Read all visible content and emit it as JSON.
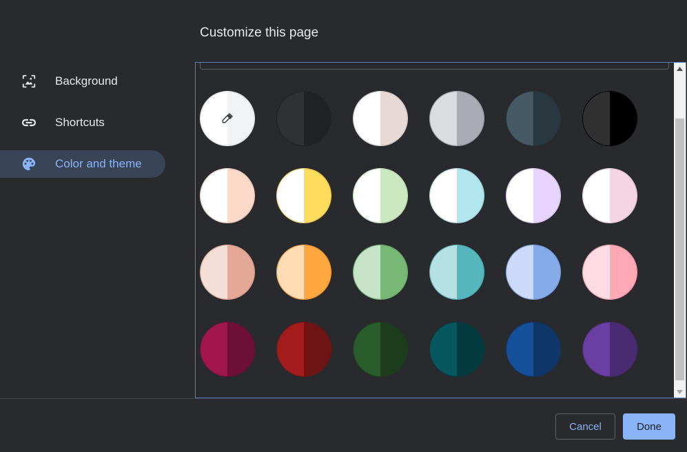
{
  "page": {
    "title": "Customize this page"
  },
  "nav": {
    "items": [
      {
        "label": "Background",
        "icon": "background-image-icon"
      },
      {
        "label": "Shortcuts",
        "icon": "link-icon"
      },
      {
        "label": "Color and theme",
        "icon": "palette-icon",
        "active": true
      }
    ]
  },
  "swatches": [
    {
      "icon": "eyedropper-icon",
      "left": "#ffffff",
      "right": "#f1f3f4",
      "border": "#f1f3f4"
    },
    {
      "left": "#2f3134",
      "right": "#202124",
      "border": "#202124"
    },
    {
      "left": "#ffffff",
      "right": "#e6d9d6",
      "border": "#e6d9d6"
    },
    {
      "left": "#dadce0",
      "right": "#a9acb5",
      "border": "#a9acb5"
    },
    {
      "left": "#455a64",
      "right": "#29373e",
      "border": "#29373e"
    },
    {
      "left": "#303030",
      "right": "#000000",
      "border": "#000000"
    },
    {
      "left": "#ffffff",
      "right": "#fcd9c8",
      "border": "#fcd9c8"
    },
    {
      "left": "#ffffff",
      "right": "#ffdc5c",
      "border": "#ffdc5c"
    },
    {
      "left": "#ffffff",
      "right": "#cbe8c1",
      "border": "#cbe8c1"
    },
    {
      "left": "#ffffff",
      "right": "#b3e5ee",
      "border": "#b3e5ee"
    },
    {
      "left": "#ffffff",
      "right": "#e8d4fd",
      "border": "#e8d4fd"
    },
    {
      "left": "#ffffff",
      "right": "#f6d5e2",
      "border": "#f6d5e2"
    },
    {
      "left": "#f5ddd8",
      "right": "#e4a996",
      "border": "#e4a996"
    },
    {
      "left": "#ffdcb3",
      "right": "#ffa83f",
      "border": "#ffa83f"
    },
    {
      "left": "#c6e3c8",
      "right": "#77b877",
      "border": "#77b877"
    },
    {
      "left": "#b5e0e4",
      "right": "#56b7bc",
      "border": "#56b7bc"
    },
    {
      "left": "#cbdaf8",
      "right": "#85ace8",
      "border": "#85ace8"
    },
    {
      "left": "#ffdce3",
      "right": "#ffa9b6",
      "border": "#ffa9b6"
    },
    {
      "left": "#a2164e",
      "right": "#6d0f37",
      "border": "#6d0f37"
    },
    {
      "left": "#a31b1b",
      "right": "#6e1414",
      "border": "#6e1414"
    },
    {
      "left": "#2a5d2c",
      "right": "#1c3d1c",
      "border": "#1c3d1c"
    },
    {
      "left": "#04585e",
      "right": "#033b40",
      "border": "#033b40"
    },
    {
      "left": "#15519a",
      "right": "#0f3668",
      "border": "#0f3668"
    },
    {
      "left": "#6a3ea3",
      "right": "#4a2a70",
      "border": "#4a2a70"
    }
  ],
  "footer": {
    "cancel_label": "Cancel",
    "done_label": "Done"
  },
  "colors": {
    "background": "#292a2d",
    "accent": "#8ab4f8",
    "active_nav_bg": "#394457",
    "panel_border": "#5b7fc4"
  }
}
